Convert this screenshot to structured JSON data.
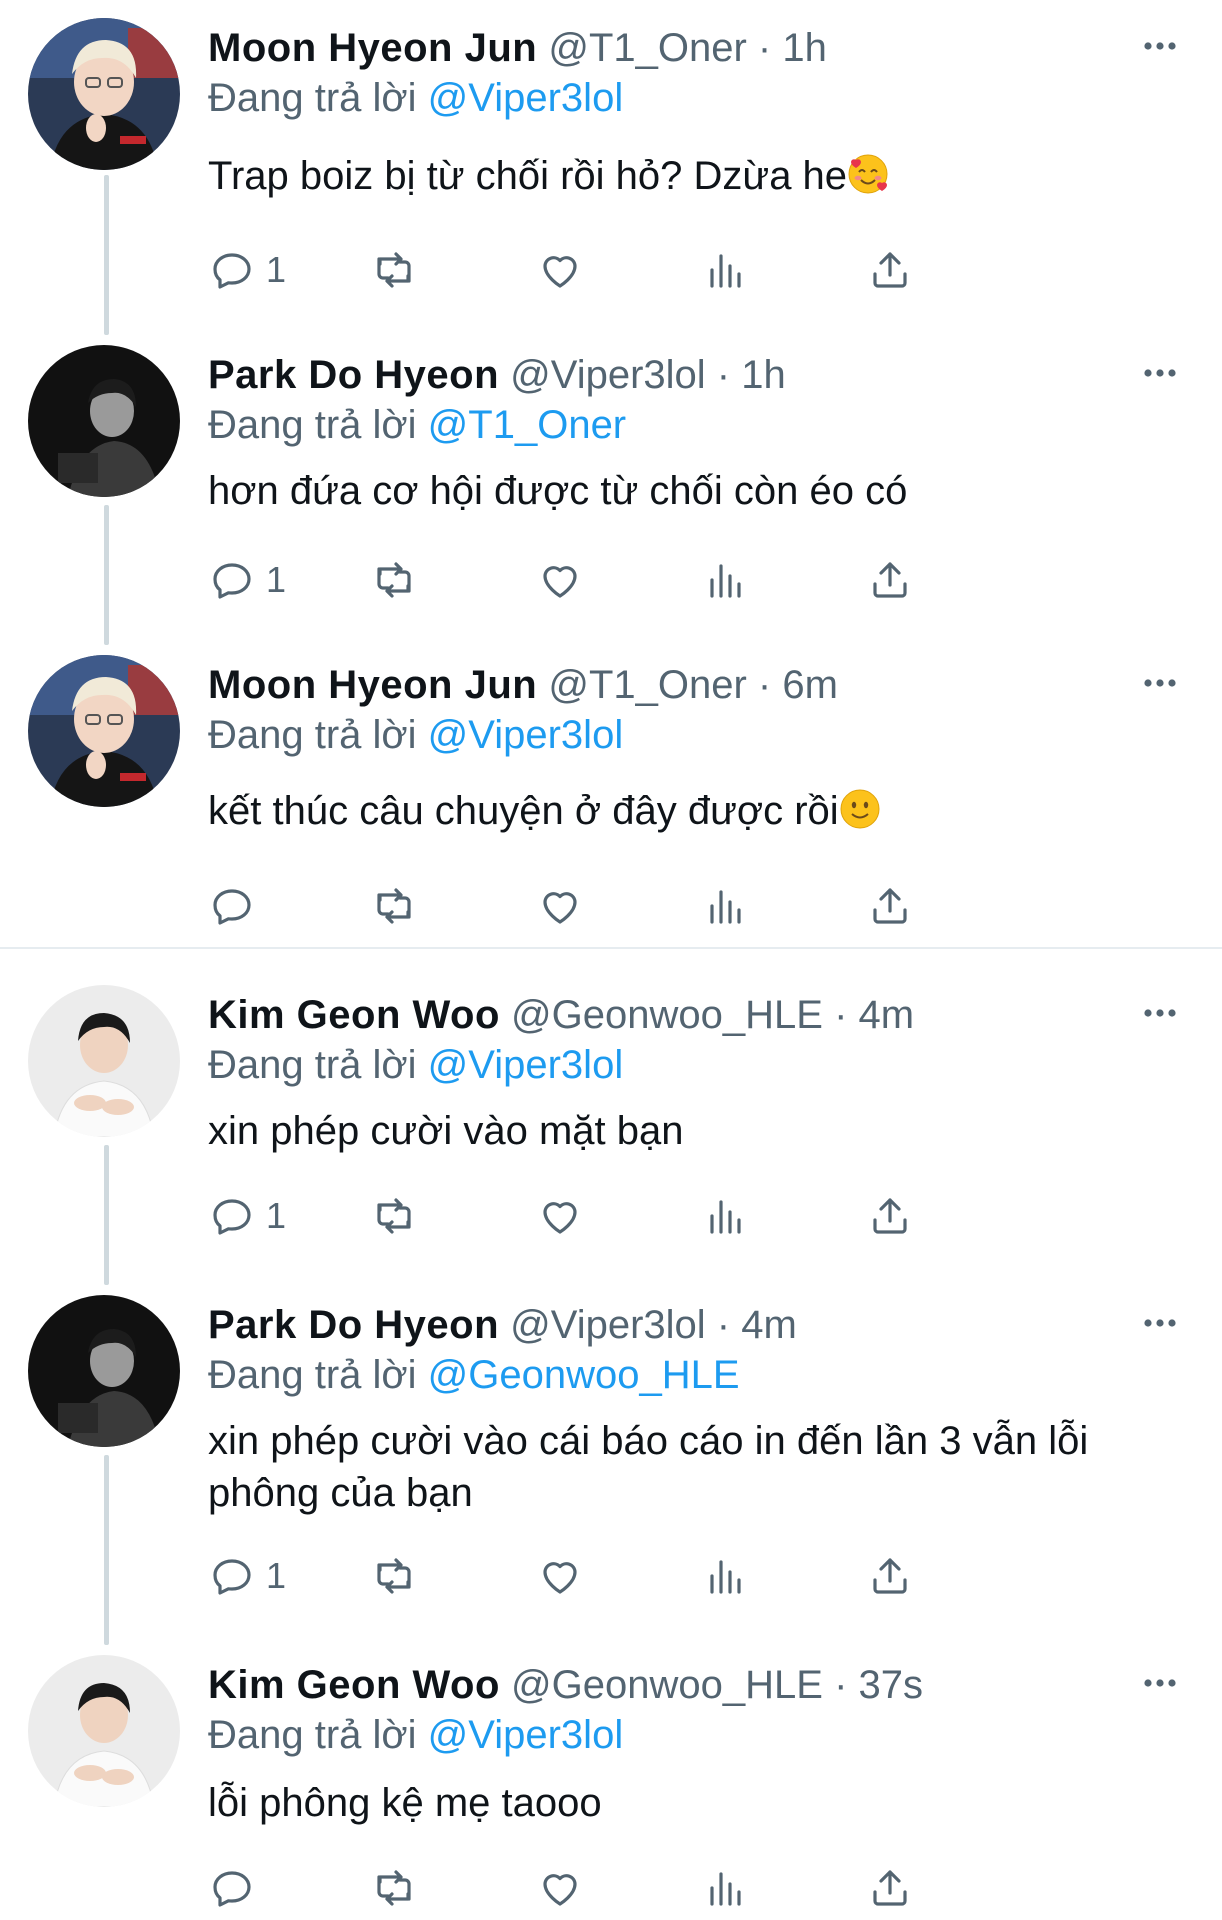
{
  "reply_prefix": "Đang trả lời",
  "colors": {
    "text": "#0f1419",
    "secondary": "#536471",
    "link": "#1d9bf0",
    "thread_line": "#cfd9de"
  },
  "tweets": [
    {
      "name": "Moon Hyeon Jun",
      "handle": "@T1_Oner",
      "time": "1h",
      "reply_to": "@Viper3lol",
      "text": "Trap boiz bị từ chối rồi hỏ? Dzừa he",
      "emoji": "smiling-face-with-hearts",
      "reply_count": "1",
      "avatar": "oner-avatar"
    },
    {
      "name": "Park Do Hyeon",
      "handle": "@Viper3lol",
      "time": "1h",
      "reply_to": "@T1_Oner",
      "text": "hơn đứa cơ hội được từ chối còn éo có",
      "emoji": "",
      "reply_count": "1",
      "avatar": "viper-avatar"
    },
    {
      "name": "Moon Hyeon Jun",
      "handle": "@T1_Oner",
      "time": "6m",
      "reply_to": "@Viper3lol",
      "text": "kết thúc câu chuyện ở đây được rồi",
      "emoji": "slightly-smiling-face",
      "reply_count": "",
      "avatar": "oner-avatar"
    },
    {
      "name": "Kim Geon Woo",
      "handle": "@Geonwoo_HLE",
      "time": "4m",
      "reply_to": "@Viper3lol",
      "text": "xin phép cười vào mặt bạn",
      "emoji": "",
      "reply_count": "1",
      "avatar": "geonwoo-avatar"
    },
    {
      "name": "Park Do Hyeon",
      "handle": "@Viper3lol",
      "time": "4m",
      "reply_to": "@Geonwoo_HLE",
      "text": "xin phép cười vào cái báo cáo in đến lần 3 vẫn lỗi phông của bạn",
      "emoji": "",
      "reply_count": "1",
      "avatar": "viper-avatar"
    },
    {
      "name": "Kim Geon Woo",
      "handle": "@Geonwoo_HLE",
      "time": "37s",
      "reply_to": "@Viper3lol",
      "text": "lỗi phông kệ mẹ taooo",
      "emoji": "",
      "reply_count": "",
      "avatar": "geonwoo-avatar"
    }
  ],
  "icons": [
    "more-icon",
    "reply-icon",
    "retweet-icon",
    "like-icon",
    "views-icon",
    "share-icon"
  ]
}
